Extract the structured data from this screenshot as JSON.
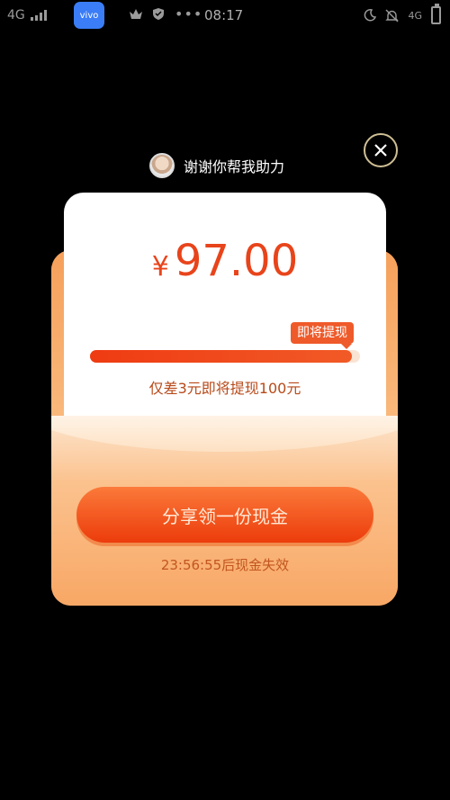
{
  "status_bar": {
    "network_left": "4G",
    "app_icon_label": "vivo",
    "dots": "•••",
    "time": "08:17",
    "network_right": "4G"
  },
  "header": {
    "helper_text": "谢谢你帮我助力"
  },
  "card": {
    "currency": "¥",
    "amount": "97.00",
    "progress_tag": "即将提现",
    "progress_fraction": 0.97,
    "hint": "仅差3元即将提现100元",
    "share_button": "分享领一份现金",
    "countdown": "23:56:55后现金失效"
  },
  "colors": {
    "accent": "#e8441b",
    "button": "#ec3c0c"
  }
}
